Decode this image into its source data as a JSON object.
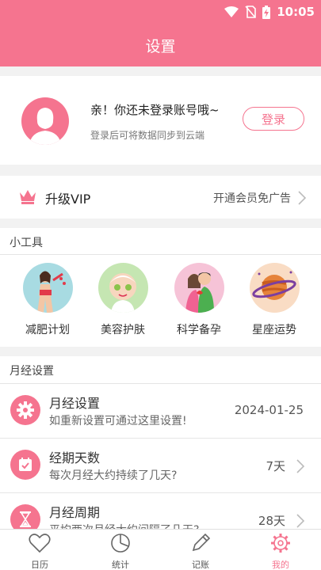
{
  "status": {
    "time": "10:05"
  },
  "header": {
    "title": "设置"
  },
  "login": {
    "title": "亲！你还未登录账号哦~",
    "subtitle": "登录后可将数据同步到云端",
    "button": "登录"
  },
  "vip": {
    "title": "升级VIP",
    "desc": "开通会员免广告"
  },
  "tools": {
    "title": "小工具",
    "items": [
      {
        "label": "减肥计划",
        "icon": "diet-plan-icon"
      },
      {
        "label": "美容护肤",
        "icon": "skincare-icon"
      },
      {
        "label": "科学备孕",
        "icon": "pregnancy-prep-icon"
      },
      {
        "label": "星座运势",
        "icon": "horoscope-icon"
      }
    ]
  },
  "mens": {
    "title": "月经设置",
    "rows": [
      {
        "title": "月经设置",
        "sub": "如重新设置可通过这里设置!",
        "value": "2024-01-25",
        "icon": "gear-icon"
      },
      {
        "title": "经期天数",
        "sub": "每次月经大约持续了几天?",
        "value": "7天",
        "icon": "calendar-icon"
      },
      {
        "title": "月经周期",
        "sub": "平均两次月经大约间隔了几天?",
        "value": "28天",
        "icon": "hourglass-icon"
      }
    ]
  },
  "tabs": [
    {
      "label": "日历",
      "icon": "heart-icon",
      "active": false
    },
    {
      "label": "统计",
      "icon": "pie-chart-icon",
      "active": false
    },
    {
      "label": "记账",
      "icon": "pencil-icon",
      "active": false
    },
    {
      "label": "我的",
      "icon": "gear-icon",
      "active": true
    }
  ],
  "colors": {
    "accent": "#f5748f"
  }
}
